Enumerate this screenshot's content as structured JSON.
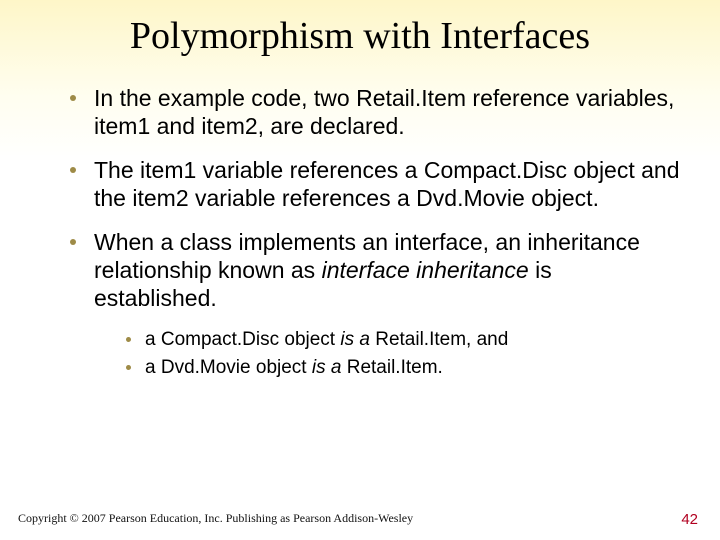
{
  "title": "Polymorphism with Interfaces",
  "bullets": {
    "b1": "In the example code, two Retail.Item reference variables, item1 and item2, are declared.",
    "b2": "The item1 variable references a Compact.Disc object and the item2 variable references a Dvd.Movie object.",
    "b3_pre": "When a class implements an interface, an inheritance relationship known as ",
    "b3_em": "interface inheritance",
    "b3_post": " is established."
  },
  "subs": {
    "s1_pre": "a Compact.Disc object ",
    "s1_em": "is a",
    "s1_post": " Retail.Item, and",
    "s2_pre": "a Dvd.Movie object ",
    "s2_em": "is a",
    "s2_post": " Retail.Item."
  },
  "footer": {
    "copyright": "Copyright © 2007 Pearson Education, Inc. Publishing as Pearson Addison-Wesley",
    "page": "42"
  }
}
